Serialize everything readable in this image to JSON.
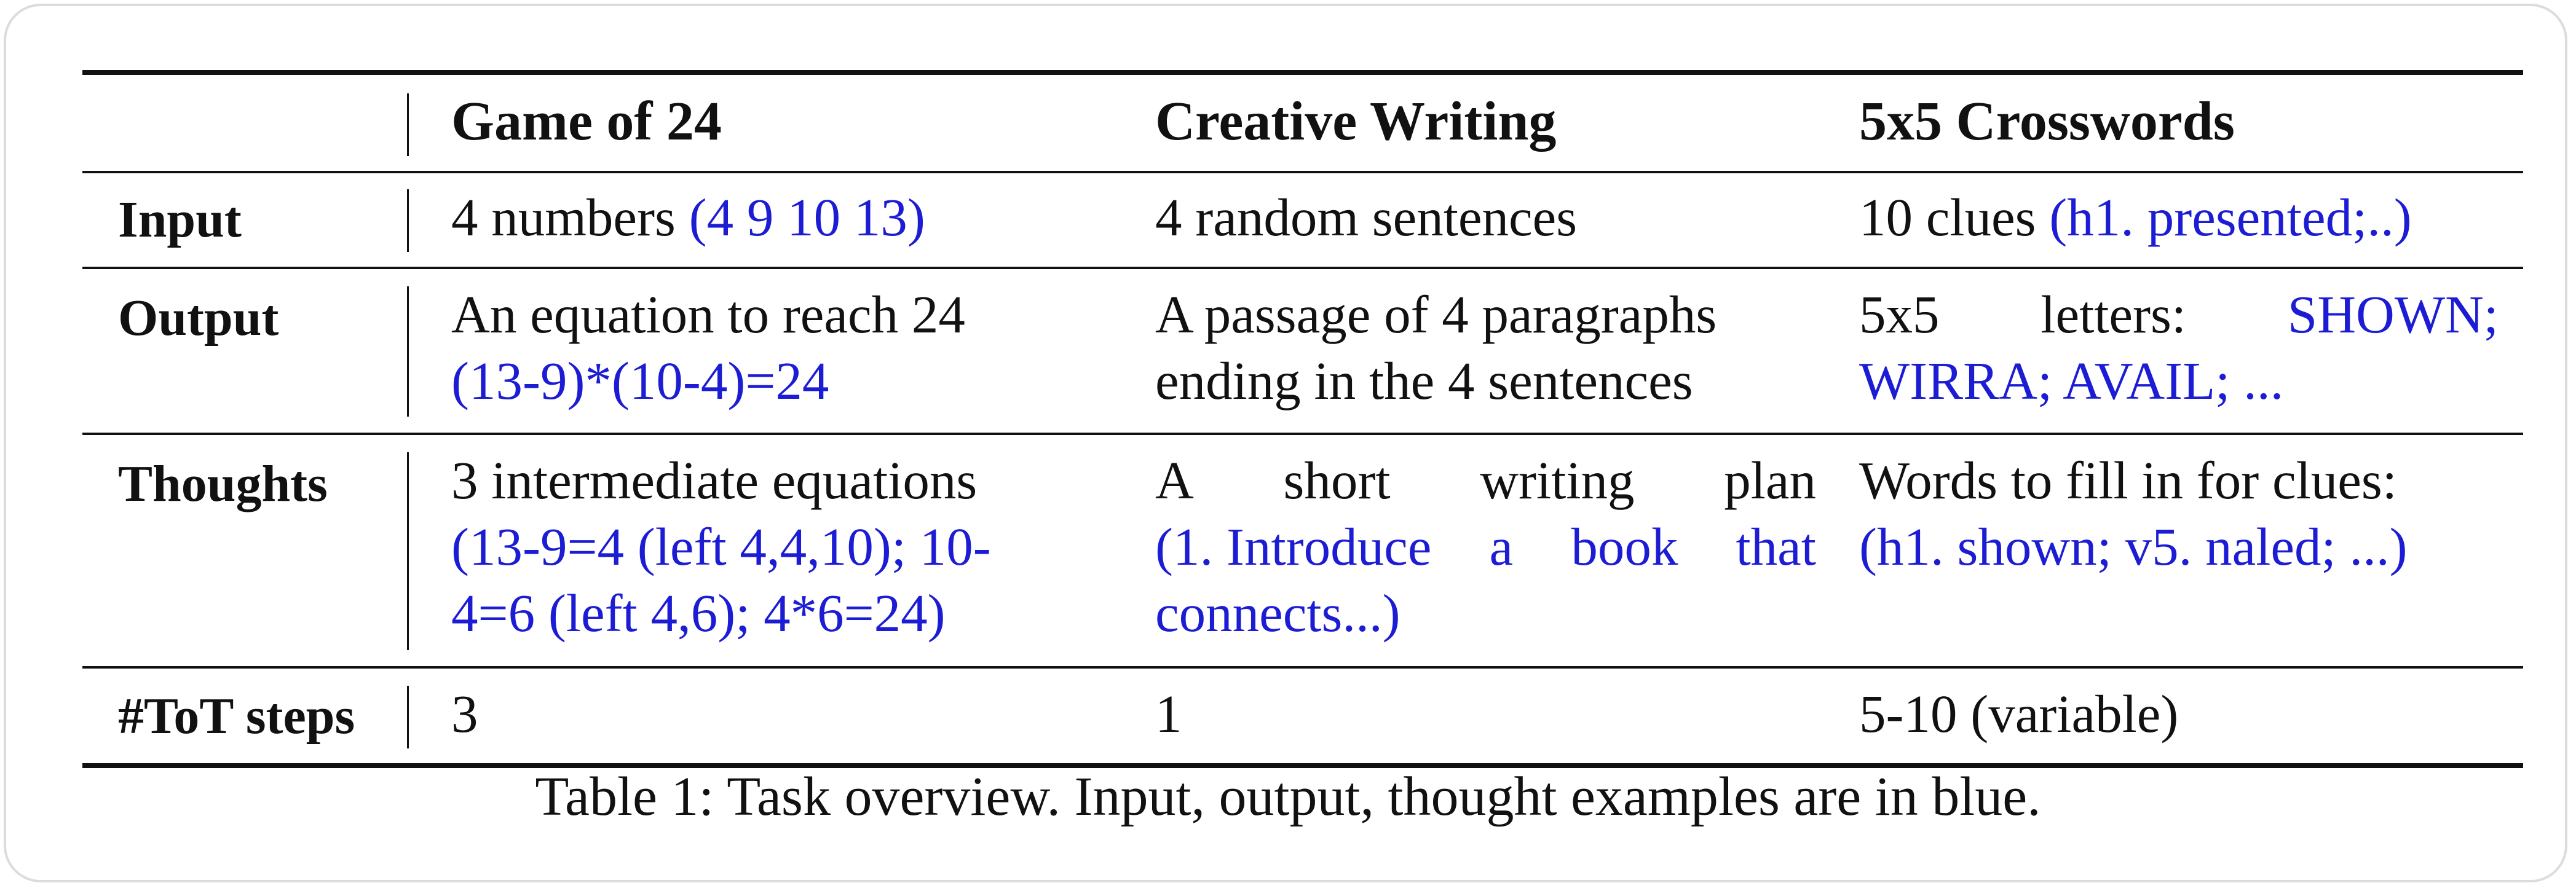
{
  "header": {
    "col1": "Game of 24",
    "col2": "Creative Writing",
    "col3": "5x5 Crosswords"
  },
  "rows": {
    "input": {
      "label": "Input",
      "c1_plain": "4 numbers ",
      "c1_blue": "(4 9 10 13)",
      "c2_plain": "4 random sentences",
      "c3_plain": "10 clues ",
      "c3_blue": "(h1. presented;..)"
    },
    "output": {
      "label": "Output",
      "c1_line1": "An equation to reach 24",
      "c1_line2_blue": "(13-9)*(10-4)=24",
      "c2_line1": "A passage of 4 paragraphs",
      "c2_line2": "ending in the 4 sentences",
      "c3_line1_a": "5x5",
      "c3_line1_b": "letters:",
      "c3_line1_blue": "SHOWN;",
      "c3_line2_blue": "WIRRA; AVAIL; ..."
    },
    "thoughts": {
      "label": "Thoughts",
      "c1_line1": "3 intermediate equations",
      "c1_line2_blue": "(13-9=4 (left 4,4,10); 10-",
      "c1_line3_blue": "4=6 (left 4,6); 4*6=24)",
      "c2_line1_words": [
        "A",
        "short",
        "writing",
        "plan"
      ],
      "c2_line2_blue_words": [
        "(1. Introduce",
        "a",
        "book",
        "that"
      ],
      "c2_line3_blue": "connects...)",
      "c3_line1": "Words to fill in for clues:",
      "c3_line2_blue": "(h1. shown; v5. naled; ...)"
    },
    "steps": {
      "label": "#ToT steps",
      "c1": "3",
      "c2": "1",
      "c3": "5-10 (variable)"
    }
  },
  "caption": "Table 1: Task overview. Input, output, thought examples are in blue.",
  "colors": {
    "example_blue": "#1c1cd4",
    "rule": "#111111"
  }
}
